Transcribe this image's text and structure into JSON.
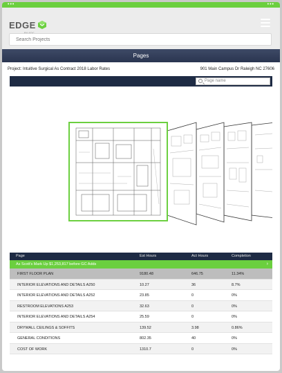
{
  "app": {
    "logo_text": "EDGE",
    "logo_sub": "BY ADC",
    "search_placeholder": "Search Projects"
  },
  "status_bar": {
    "left_dots": "•••",
    "right_dots": "•••"
  },
  "colors": {
    "accent_green": "#6bcf3f",
    "navy": "#1e2b44"
  },
  "header": {
    "title": "Pages"
  },
  "project": {
    "label": "Project:",
    "name": "Intuitive Surgical As Contract 2018 Labor Rates",
    "address": "901 Main Campus Dr  Raleigh NC 27606"
  },
  "viewer": {
    "search_placeholder": "Page name"
  },
  "table": {
    "columns": [
      "Page",
      "Est Hours",
      "Act Hours",
      "Completion"
    ],
    "group": {
      "label": "As Scott's Mark Up $1,253,817 before GC Adds",
      "chevron": "›"
    },
    "rows": [
      {
        "page": "FIRST FLOOR PLAN",
        "est": "9180.48",
        "act": "646.75",
        "completion": "11.34%",
        "selected": true
      },
      {
        "page": "INTERIOR ELEVATIONS AND DETAILS A250",
        "est": "10.27",
        "act": "36",
        "completion": "8.7%"
      },
      {
        "page": "INTERIOR ELEVATIONS AND DETAILS A252",
        "est": "23.85",
        "act": "0",
        "completion": "0%"
      },
      {
        "page": "RESTROOM ELEVATIONS A253",
        "est": "32.63",
        "act": "0",
        "completion": "0%"
      },
      {
        "page": "INTERIOR ELEVATIONS AND DETAILS A254",
        "est": "25.59",
        "act": "0",
        "completion": "0%"
      },
      {
        "page": "DRYWALL CEILINGS & SOFFITS",
        "est": "139.52",
        "act": "3.98",
        "completion": "0.86%"
      },
      {
        "page": "GENERAL CONDITIONS",
        "est": "802.35",
        "act": "40",
        "completion": "0%"
      },
      {
        "page": "COST OF WORK",
        "est": "1310.7",
        "act": "0",
        "completion": "0%"
      }
    ]
  }
}
